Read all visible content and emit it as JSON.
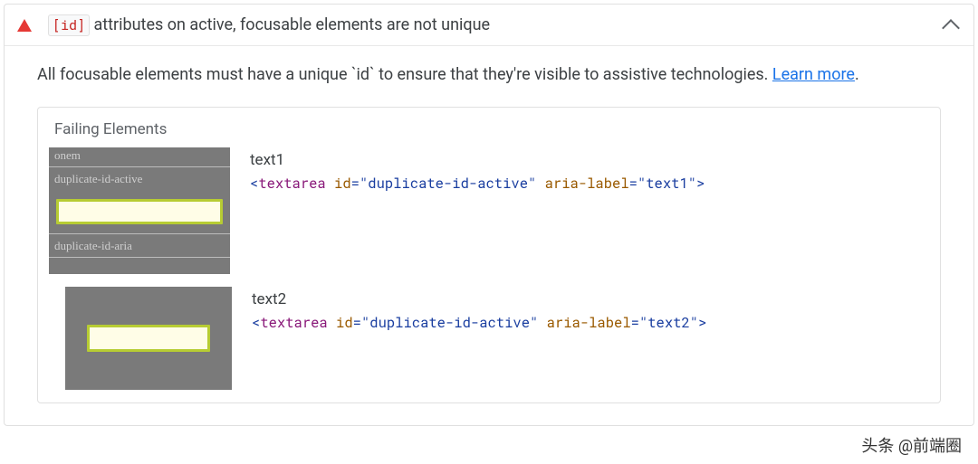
{
  "audit": {
    "badge": "[id]",
    "title_tail": " attributes on active, focusable elements are not unique",
    "description_prefix": "All focusable elements must have a unique `id` to ensure that they're visible to assistive technologies. ",
    "learn_more": "Learn more",
    "description_suffix": "."
  },
  "failing": {
    "heading": "Failing Elements",
    "items": [
      {
        "label": "text1",
        "snippet": {
          "tag": "textarea",
          "attrs": [
            {
              "name": "id",
              "value": "duplicate-id-active"
            },
            {
              "name": "aria-label",
              "value": "text1"
            }
          ]
        },
        "thumb_labels": [
          "onem",
          "duplicate-id-active",
          "duplicate-id-aria"
        ]
      },
      {
        "label": "text2",
        "snippet": {
          "tag": "textarea",
          "attrs": [
            {
              "name": "id",
              "value": "duplicate-id-active"
            },
            {
              "name": "aria-label",
              "value": "text2"
            }
          ]
        },
        "thumb_labels": []
      }
    ]
  },
  "watermark": "头条 @前端圈"
}
